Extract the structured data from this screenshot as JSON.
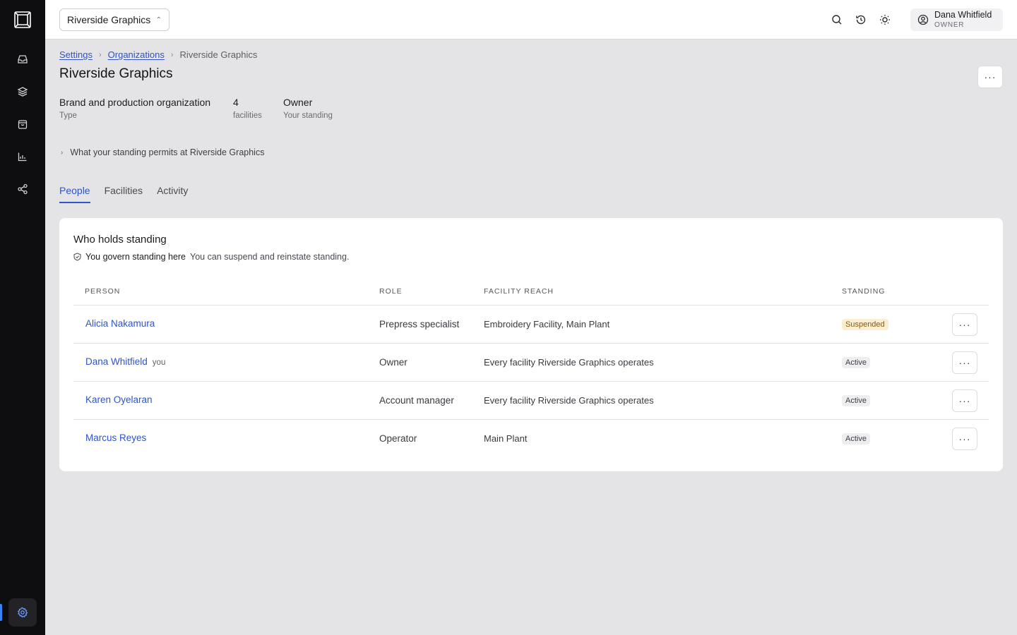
{
  "org_switcher": {
    "label": "Riverside Graphics"
  },
  "user": {
    "name": "Dana Whitfield",
    "role": "OWNER"
  },
  "breadcrumb": {
    "items": [
      "Settings",
      "Organizations",
      "Riverside Graphics"
    ]
  },
  "page": {
    "title": "Riverside Graphics",
    "more_label": "···"
  },
  "stats": [
    {
      "value": "Brand and production organization",
      "label": "Type"
    },
    {
      "value": "4",
      "label": "facilities"
    },
    {
      "value": "Owner",
      "label": "Your standing"
    }
  ],
  "permits": {
    "label": "What your standing permits at Riverside Graphics"
  },
  "tabs": [
    {
      "label": "People",
      "active": true
    },
    {
      "label": "Facilities",
      "active": false
    },
    {
      "label": "Activity",
      "active": false
    }
  ],
  "card": {
    "title": "Who holds standing",
    "govern_strong": "You govern standing here",
    "govern_text": "You can suspend and reinstate standing.",
    "columns": [
      "PERSON",
      "ROLE",
      "FACILITY REACH",
      "STANDING"
    ],
    "rows": [
      {
        "person": "Alicia Nakamura",
        "you": "",
        "role": "Prepress specialist",
        "reach": "Embroidery Facility, Main Plant",
        "standing": "Suspended"
      },
      {
        "person": "Dana Whitfield",
        "you": "you",
        "role": "Owner",
        "reach": "Every facility Riverside Graphics operates",
        "standing": "Active"
      },
      {
        "person": "Karen Oyelaran",
        "you": "",
        "role": "Account manager",
        "reach": "Every facility Riverside Graphics operates",
        "standing": "Active"
      },
      {
        "person": "Marcus Reyes",
        "you": "",
        "role": "Operator",
        "reach": "Main Plant",
        "standing": "Active"
      }
    ],
    "row_more_label": "···"
  },
  "colors": {
    "accent": "#2d54c8",
    "rail": "#0e0e10",
    "suspended_bg": "#fbeed0"
  },
  "icons": {
    "rail": [
      "logo-icon",
      "inbox-icon",
      "layers-icon",
      "package-icon",
      "chart-icon",
      "share-icon",
      "settings-icon"
    ],
    "topbar": [
      "search-icon",
      "history-icon",
      "sun-icon",
      "user-circle-icon"
    ]
  }
}
